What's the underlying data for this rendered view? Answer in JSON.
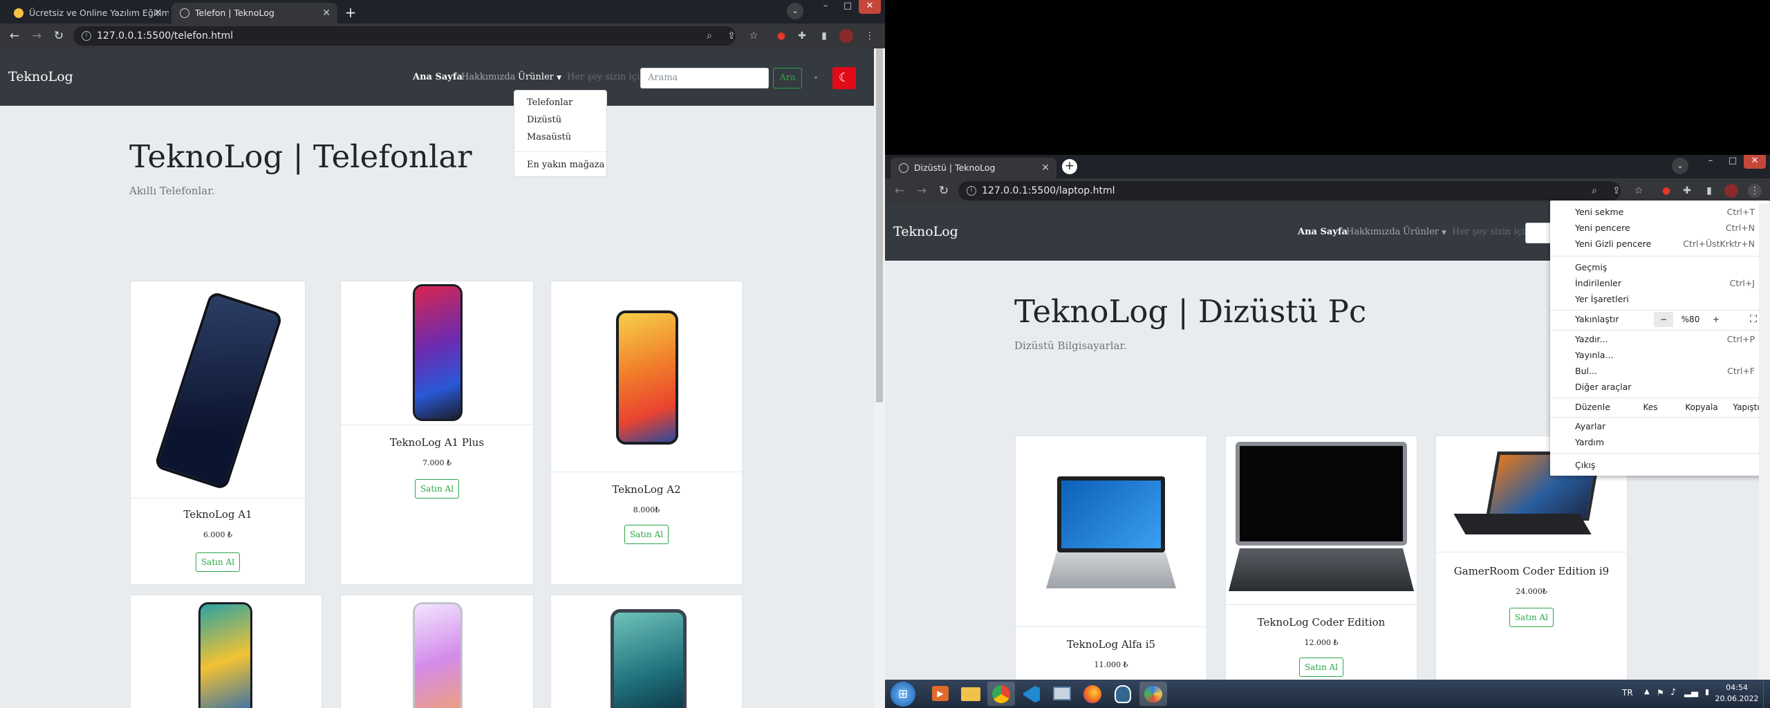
{
  "left_window": {
    "tabs": [
      {
        "title": "Ücretsiz ve Online Yazılım Eğitimi",
        "active": false
      },
      {
        "title": "Telefon | TeknoLog",
        "active": true
      }
    ],
    "url": "127.0.0.1:5500/telefon.html",
    "nav": {
      "brand": "TeknoLog",
      "links": [
        "Ana Sayfa",
        "Hakkımızda",
        "Ürünler",
        "Her şey sizin için."
      ],
      "search_placeholder": "Arama",
      "search_button": "Ara"
    },
    "dropdown": {
      "items": [
        "Telefonlar",
        "Dizüstü",
        "Masaüstü",
        "En yakın mağaza"
      ]
    },
    "hero": {
      "title": "TeknoLog | Telefonlar",
      "subtitle": "Akıllı Telefonlar."
    },
    "products": [
      {
        "name": "TeknoLog A1",
        "price": "6.000 ₺",
        "button": "Satın Al"
      },
      {
        "name": "TeknoLog A1 Plus",
        "price": "7.000 ₺",
        "button": "Satın Al"
      },
      {
        "name": "TeknoLog A2",
        "price": "8.000₺",
        "button": "Satın Al"
      }
    ]
  },
  "right_window": {
    "tabs": [
      {
        "title": "Dizüstü | TeknoLog",
        "active": true
      }
    ],
    "url": "127.0.0.1:5500/laptop.html",
    "nav": {
      "brand": "TeknoLog",
      "links": [
        "Ana Sayfa",
        "Hakkımızda",
        "Ürünler",
        "Her şey sizin için."
      ]
    },
    "hero": {
      "title": "TeknoLog | Dizüstü Pc",
      "subtitle": "Dizüstü Bilgisayarlar."
    },
    "products": [
      {
        "name": "TeknoLog Alfa i5",
        "price": "11.000 ₺",
        "button": "Satın Al"
      },
      {
        "name": "TeknoLog Coder Edition",
        "price": "12.000 ₺",
        "button": "Satın Al"
      },
      {
        "name": "GamerRoom Coder Edition i9",
        "price": "24.000₺",
        "button": "Satın Al"
      }
    ]
  },
  "chrome_menu": {
    "items": [
      {
        "label": "Yeni sekme",
        "shortcut": "Ctrl+T"
      },
      {
        "label": "Yeni pencere",
        "shortcut": "Ctrl+N"
      },
      {
        "label": "Yeni Gizli pencere",
        "shortcut": "Ctrl+ÜstKrktr+N"
      },
      {
        "label": "Geçmiş",
        "shortcut": ""
      },
      {
        "label": "İndirilenler",
        "shortcut": "Ctrl+J"
      },
      {
        "label": "Yer İşaretleri",
        "shortcut": ""
      },
      {
        "label": "Yakınlaştır",
        "shortcut": ""
      },
      {
        "label": "Yazdır...",
        "shortcut": "Ctrl+P"
      },
      {
        "label": "Yayınla...",
        "shortcut": ""
      },
      {
        "label": "Bul...",
        "shortcut": "Ctrl+F"
      },
      {
        "label": "Diğer araçlar",
        "shortcut": ""
      },
      {
        "label": "Düzenle",
        "shortcut": ""
      },
      {
        "label": "Ayarlar",
        "shortcut": ""
      },
      {
        "label": "Yardım",
        "shortcut": ""
      },
      {
        "label": "Çıkış",
        "shortcut": ""
      }
    ],
    "zoom": {
      "minus": "−",
      "value": "%80",
      "plus": "+"
    },
    "edit": {
      "cut": "Kes",
      "copy": "Kopyala",
      "paste": "Yapıştır"
    }
  },
  "taskbar": {
    "language": "TR",
    "time": "04:54",
    "date": "20.06.2022"
  },
  "colors": {
    "navbar": "#343a40",
    "accent_green": "#28a745",
    "flag_red": "#e30a17"
  }
}
